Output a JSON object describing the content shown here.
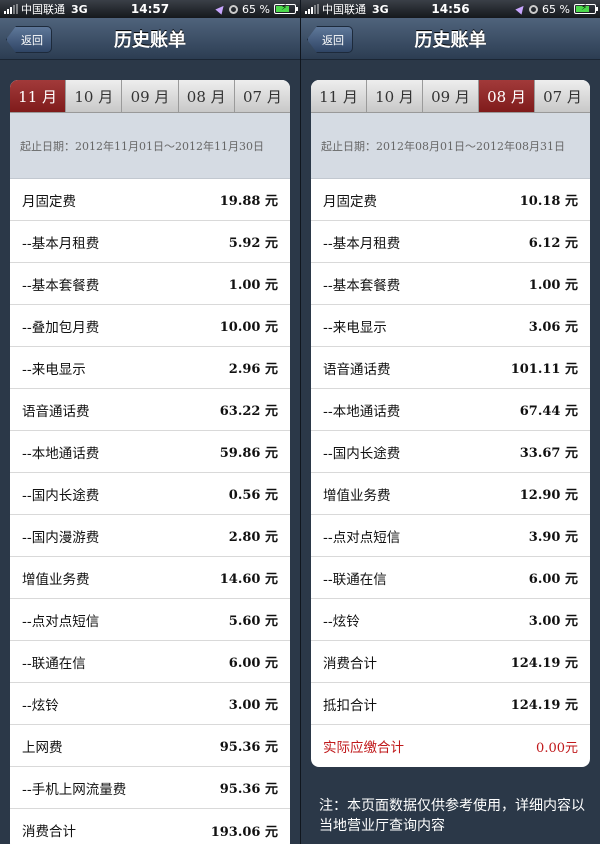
{
  "screens": [
    {
      "status": {
        "carrier": "中国联通",
        "network": "3G",
        "time": "14:57",
        "battery": "65 %"
      },
      "nav": {
        "back": "返回",
        "title": "历史账单"
      },
      "tabs": [
        "11 月",
        "10 月",
        "09 月",
        "08 月",
        "07 月"
      ],
      "active_tab": 0,
      "date_range": "起止日期：2012年11月01日～2012年11月30日",
      "rows": [
        {
          "label": "月固定费",
          "amount": "19.88 元"
        },
        {
          "label": "--基本月租费",
          "amount": "5.92 元"
        },
        {
          "label": "--基本套餐费",
          "amount": "1.00 元"
        },
        {
          "label": "--叠加包月费",
          "amount": "10.00 元"
        },
        {
          "label": "--来电显示",
          "amount": "2.96 元"
        },
        {
          "label": "语音通话费",
          "amount": "63.22 元"
        },
        {
          "label": "--本地通话费",
          "amount": "59.86 元"
        },
        {
          "label": "--国内长途费",
          "amount": "0.56 元"
        },
        {
          "label": "--国内漫游费",
          "amount": "2.80 元"
        },
        {
          "label": "增值业务费",
          "amount": "14.60 元"
        },
        {
          "label": "--点对点短信",
          "amount": "5.60 元"
        },
        {
          "label": "--联通在信",
          "amount": "6.00 元"
        },
        {
          "label": "--炫铃",
          "amount": "3.00 元"
        },
        {
          "label": "上网费",
          "amount": "95.36 元"
        },
        {
          "label": "--手机上网流量费",
          "amount": "95.36 元"
        },
        {
          "label": "消费合计",
          "amount": "193.06 元"
        }
      ]
    },
    {
      "status": {
        "carrier": "中国联通",
        "network": "3G",
        "time": "14:56",
        "battery": "65 %"
      },
      "nav": {
        "back": "返回",
        "title": "历史账单"
      },
      "tabs": [
        "11 月",
        "10 月",
        "09 月",
        "08 月",
        "07 月"
      ],
      "active_tab": 3,
      "date_range": "起止日期：2012年08月01日～2012年08月31日",
      "rows": [
        {
          "label": "月固定费",
          "amount": "10.18 元"
        },
        {
          "label": "--基本月租费",
          "amount": "6.12 元"
        },
        {
          "label": "--基本套餐费",
          "amount": "1.00 元"
        },
        {
          "label": "--来电显示",
          "amount": "3.06 元"
        },
        {
          "label": "语音通话费",
          "amount": "101.11 元"
        },
        {
          "label": "--本地通话费",
          "amount": "67.44 元"
        },
        {
          "label": "--国内长途费",
          "amount": "33.67 元"
        },
        {
          "label": "增值业务费",
          "amount": "12.90 元"
        },
        {
          "label": "--点对点短信",
          "amount": "3.90 元"
        },
        {
          "label": "--联通在信",
          "amount": "6.00 元"
        },
        {
          "label": "--炫铃",
          "amount": "3.00 元"
        },
        {
          "label": "消费合计",
          "amount": "124.19 元"
        },
        {
          "label": "抵扣合计",
          "amount": "124.19 元"
        },
        {
          "label": "实际应缴合计",
          "amount": "0.00元",
          "highlight": true
        }
      ],
      "note": "注：本页面数据仅供参考使用，详细内容以当地营业厅查询内容"
    }
  ],
  "colors": {
    "active_tab": "#8f2a2a",
    "total_text": "#c0191b",
    "background": "#2b3848"
  }
}
